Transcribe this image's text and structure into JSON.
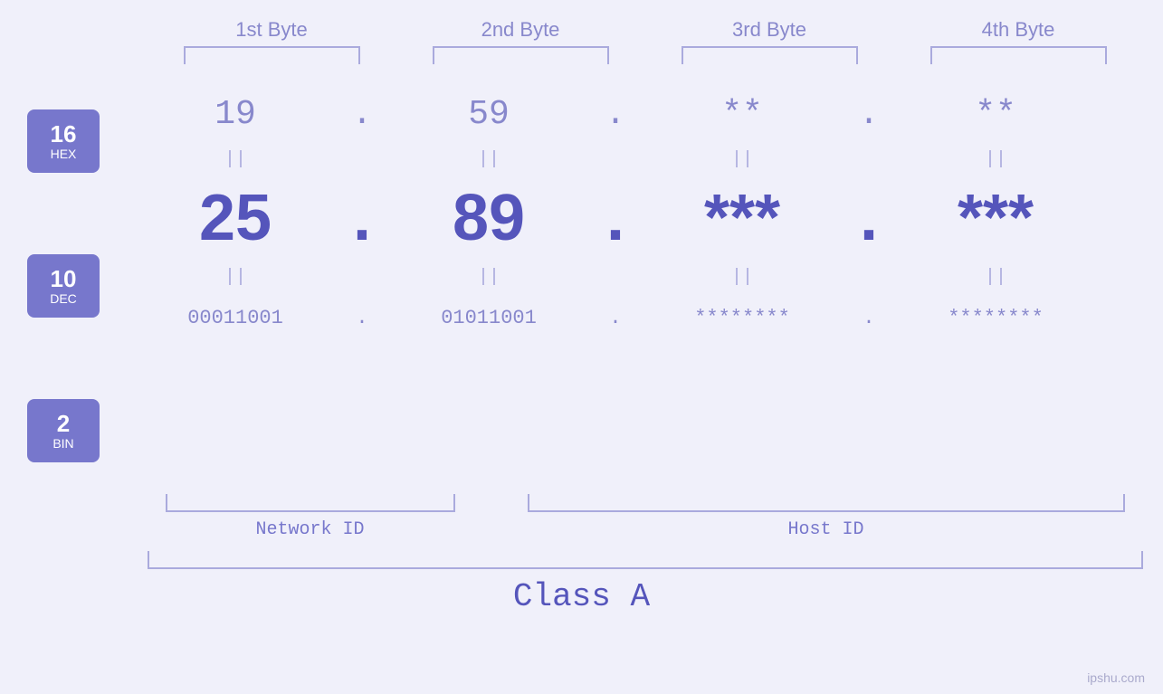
{
  "bytes": {
    "headers": [
      "1st Byte",
      "2nd Byte",
      "3rd Byte",
      "4th Byte"
    ]
  },
  "badges": [
    {
      "number": "16",
      "label": "HEX"
    },
    {
      "number": "10",
      "label": "DEC"
    },
    {
      "number": "2",
      "label": "BIN"
    }
  ],
  "hex_row": {
    "values": [
      "19",
      "59",
      "**",
      "**"
    ],
    "dots": [
      ".",
      ".",
      ".",
      ""
    ]
  },
  "dec_row": {
    "values": [
      "25",
      "89",
      "***",
      "***"
    ],
    "dots": [
      ".",
      ".",
      ".",
      ""
    ]
  },
  "bin_row": {
    "values": [
      "00011001",
      "01011001",
      "********",
      "********"
    ],
    "dots": [
      ".",
      ".",
      ".",
      ""
    ]
  },
  "labels": {
    "network_id": "Network ID",
    "host_id": "Host ID",
    "class": "Class A"
  },
  "watermark": "ipshu.com"
}
